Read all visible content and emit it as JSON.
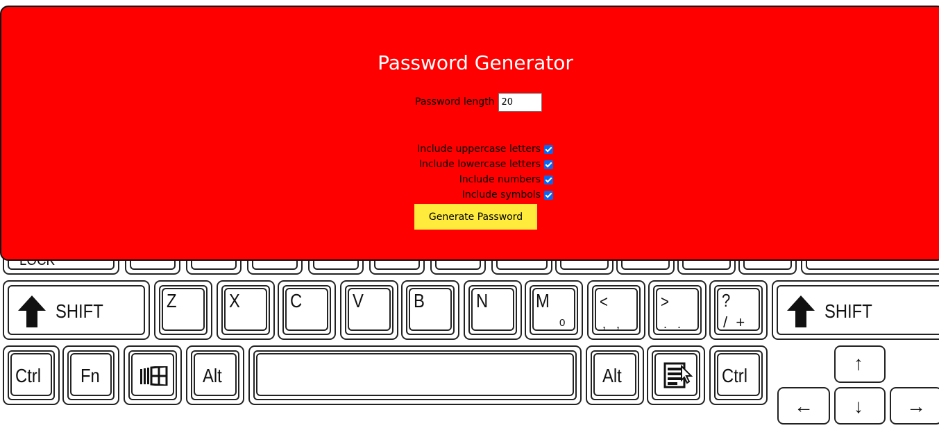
{
  "app": {
    "title": "Password Generator"
  },
  "form": {
    "length_label": "Password length",
    "length_value": "20",
    "options": [
      {
        "label": "Include uppercase letters",
        "checked": true
      },
      {
        "label": "Include lowercase letters",
        "checked": true
      },
      {
        "label": "Include numbers",
        "checked": true
      },
      {
        "label": "Include symbols",
        "checked": true
      }
    ],
    "generate_label": "Generate Password"
  },
  "keyboard": {
    "top_row_fragment": "LOCK",
    "letters": [
      "Z",
      "X",
      "C",
      "V",
      "B",
      "N",
      "M"
    ],
    "m_sub": "0",
    "punct": [
      {
        "top": "<",
        "bottom": ",   ,"
      },
      {
        "top": ">",
        "bottom": ".   ."
      },
      {
        "top": "?",
        "bottom": "/  +"
      }
    ],
    "shift_label": "SHIFT",
    "ctrl_label": "Ctrl",
    "fn_label": "Fn",
    "alt_label": "Alt",
    "arrows": {
      "up": "↑",
      "left": "←",
      "down": "↓",
      "right": "→"
    }
  },
  "colors": {
    "panel": "#ff0000",
    "title_text": "#ffffff",
    "button": "#ffeb3b",
    "checkbox": "#0a67f2"
  }
}
